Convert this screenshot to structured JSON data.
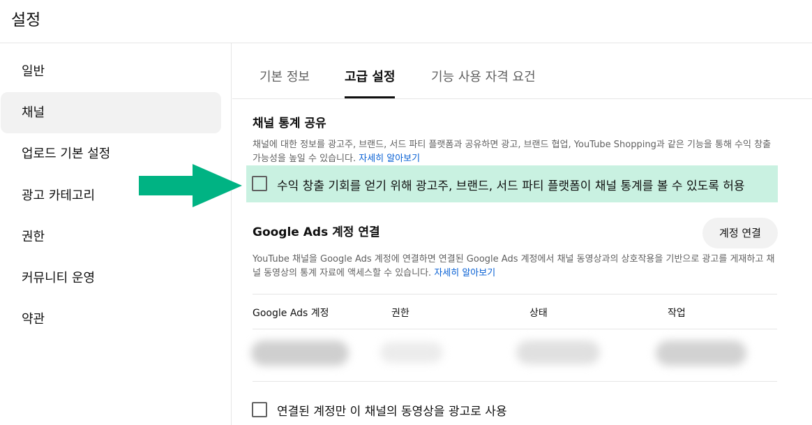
{
  "page": {
    "title": "설정"
  },
  "sidebar": {
    "items": [
      {
        "label": "일반"
      },
      {
        "label": "채널"
      },
      {
        "label": "업로드 기본 설정"
      },
      {
        "label": "광고 카테고리"
      },
      {
        "label": "권한"
      },
      {
        "label": "커뮤니티 운영"
      },
      {
        "label": "약관"
      }
    ],
    "active_index": 1
  },
  "tabs": [
    {
      "label": "기본 정보"
    },
    {
      "label": "고급 설정"
    },
    {
      "label": "기능 사용 자격 요건"
    }
  ],
  "active_tab": 1,
  "stats_sharing": {
    "title": "채널 통계 공유",
    "description": "채널에 대한 정보를 광고주, 브랜드, 서드 파티 플랫폼과 공유하면 광고, 브랜드 협업, YouTube Shopping과 같은 기능을 통해 수익 창출 가능성을 높일 수 있습니다.",
    "link": "자세히 알아보기",
    "checkbox_label": "수익 창출 기회를 얻기 위해 광고주, 브랜드, 서드 파티 플랫폼이 채널 통계를 볼 수 있도록 허용",
    "checked": false,
    "highlight_color": "#c9f1e1",
    "arrow_color": "#00b383"
  },
  "google_ads": {
    "title": "Google Ads 계정 연결",
    "connect_button": "계정 연결",
    "description": "YouTube 채널을 Google Ads 계정에 연결하면 연결된 Google Ads 계정에서 채널 동영상과의 상호작용을 기반으로 광고를 게재하고 채널 동영상의 통계 자료에 액세스할 수 있습니다.",
    "link": "자세히 알아보기",
    "table": {
      "headers": [
        "Google Ads 계정",
        "권한",
        "상태",
        "작업"
      ]
    },
    "checkbox_label": "연결된 계정만 이 채널의 동영상을 광고로 사용",
    "checked": false
  },
  "colors": {
    "link": "#065fd4",
    "text_primary": "#0f0f0f",
    "text_secondary": "#606060"
  }
}
